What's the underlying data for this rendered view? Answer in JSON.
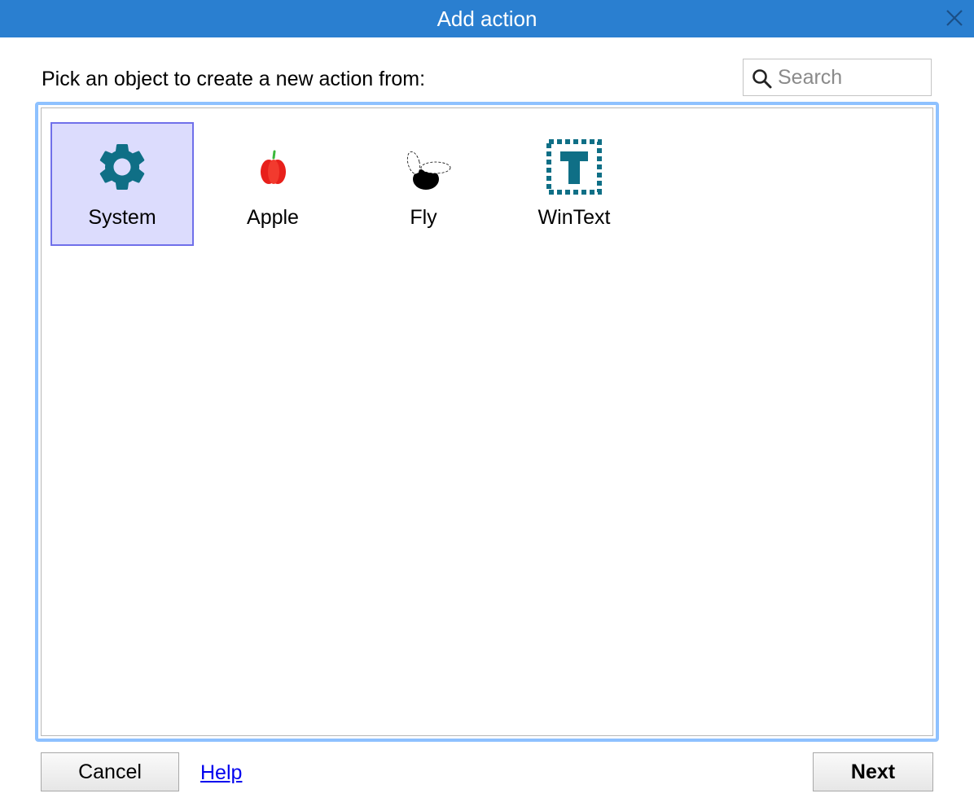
{
  "window": {
    "title": "Add action",
    "close_icon": "close-icon"
  },
  "prompt": "Pick an object to create a new action from:",
  "search": {
    "placeholder": "Search",
    "value": "",
    "icon": "search-icon"
  },
  "objects": [
    {
      "label": "System",
      "icon": "gear-icon",
      "selected": true,
      "color": "#0f6f86"
    },
    {
      "label": "Apple",
      "icon": "apple-icon",
      "selected": false,
      "color": "#e8201b"
    },
    {
      "label": "Fly",
      "icon": "fly-icon",
      "selected": false,
      "color": "#000000"
    },
    {
      "label": "WinText",
      "icon": "wintext-icon",
      "selected": false,
      "color": "#0f6f86"
    }
  ],
  "footer": {
    "cancel_label": "Cancel",
    "help_label": "Help",
    "next_label": "Next"
  },
  "colors": {
    "titlebar": "#2a7fd0",
    "selection_bg": "#dcdcfd",
    "selection_border": "#7070ea",
    "focus_ring": "#8ec1ff",
    "link": "#0000ee"
  }
}
